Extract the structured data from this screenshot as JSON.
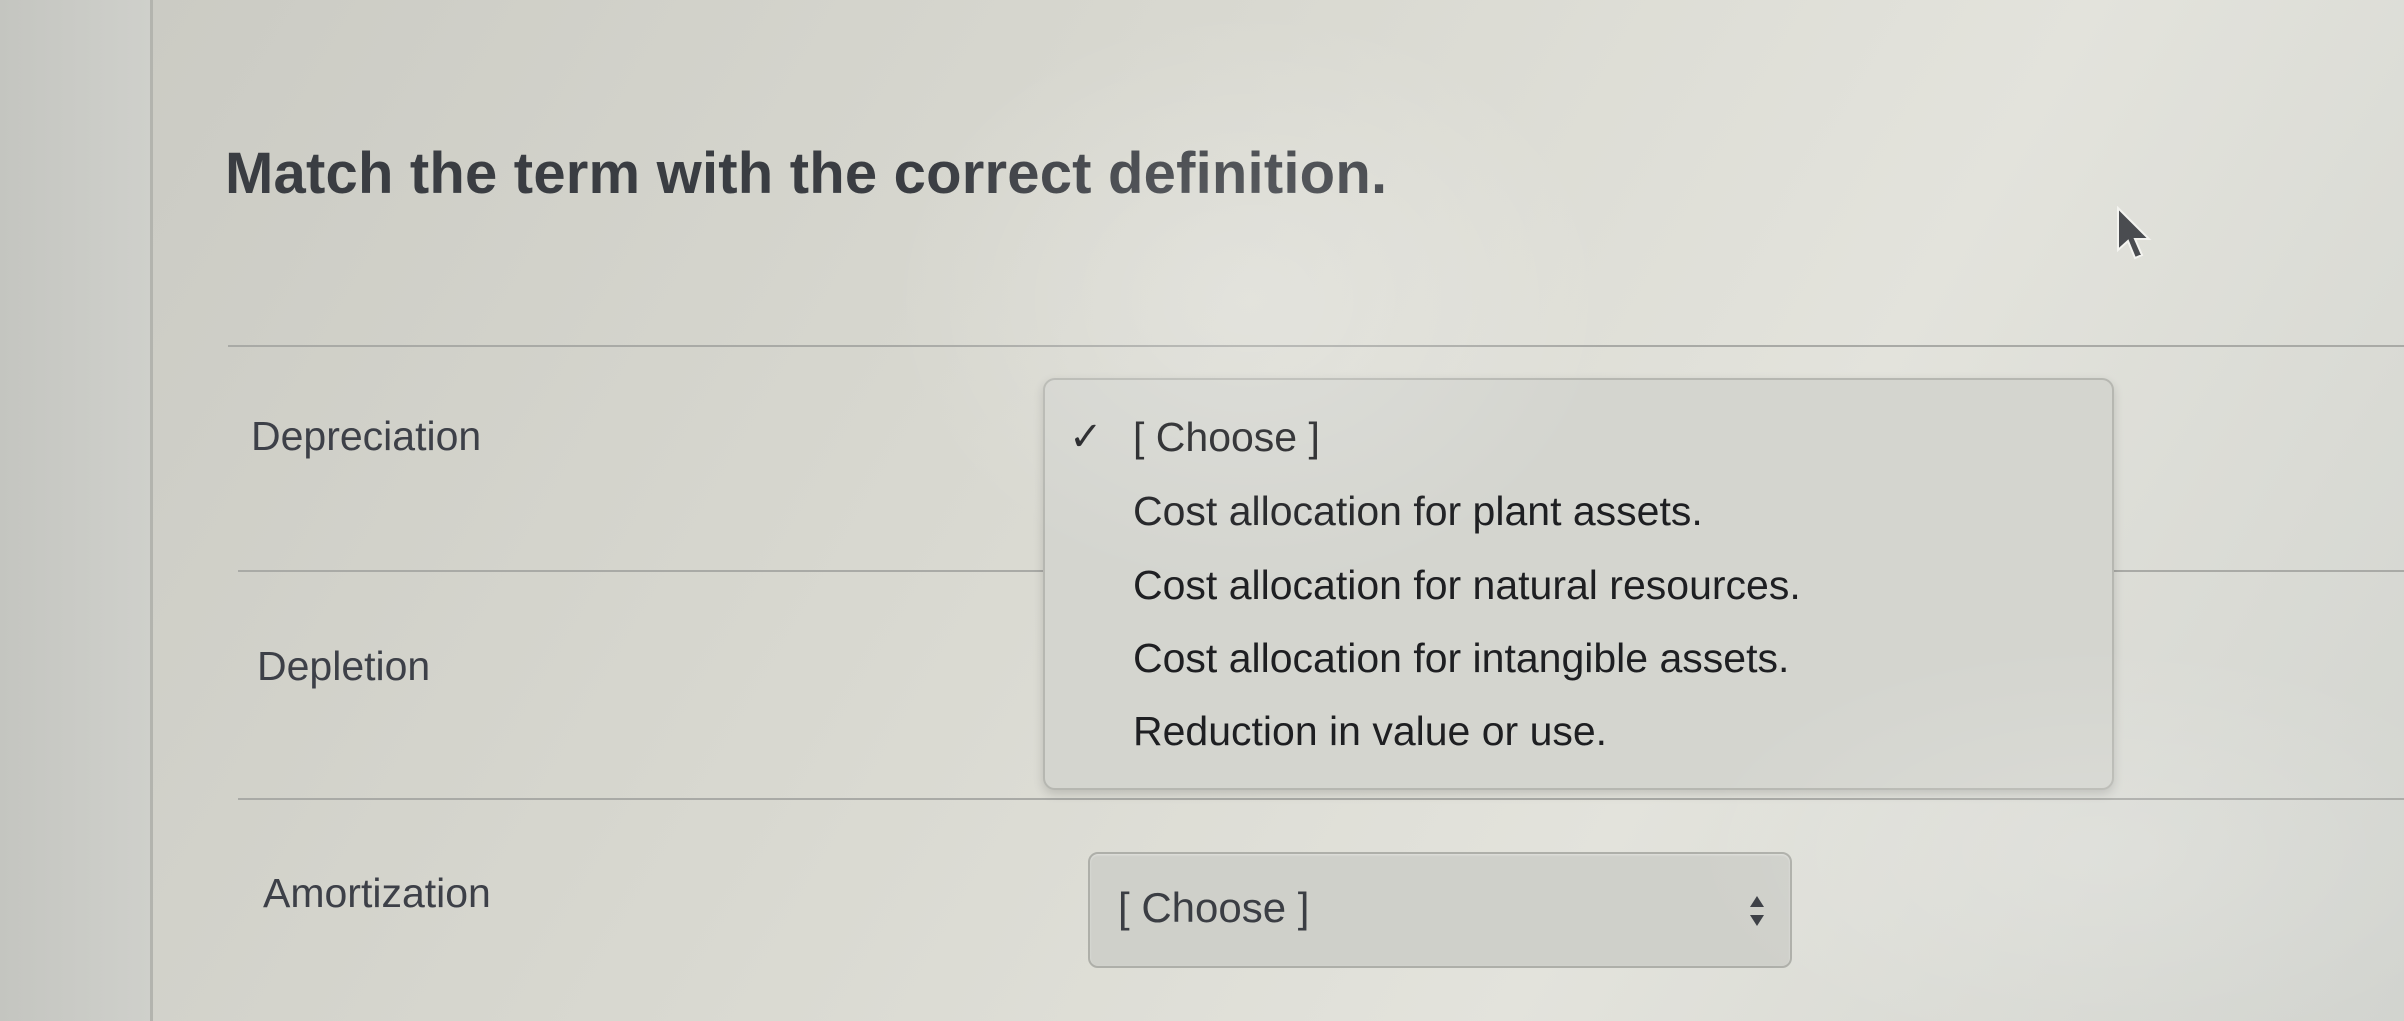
{
  "question": {
    "title": "Match the term with the correct definition."
  },
  "rows": [
    {
      "term": "Depreciation"
    },
    {
      "term": "Depletion"
    },
    {
      "term": "Amortization"
    }
  ],
  "open_dropdown": {
    "checkmark": "✓",
    "options": [
      "[ Choose ]",
      "Cost allocation for plant assets.",
      "Cost allocation for natural resources.",
      "Cost allocation for intangible assets.",
      "Reduction in value or use."
    ],
    "selected_index": 0
  },
  "amortization_select": {
    "value": "[ Choose ]"
  },
  "colors": {
    "title": "#3a3d42",
    "dropdown_bg": "#d4d5cf",
    "divider": "#a9aaa6"
  },
  "icons": {
    "cursor": "mouse-pointer-icon",
    "select_arrows": "up-down-arrows-icon",
    "check": "checkmark-icon"
  }
}
